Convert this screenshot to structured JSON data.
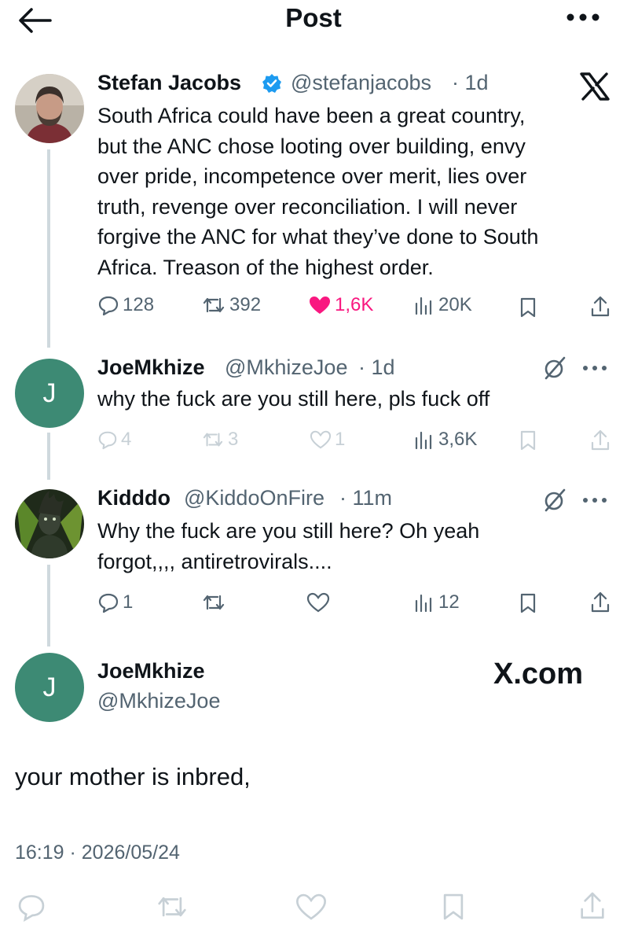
{
  "header": {
    "title": "Post"
  },
  "tweets": [
    {
      "name": "Stefan Jacobs",
      "handle": "@stefanjacobs",
      "time": "· 1d",
      "verified": true,
      "text_lines": [
        "South Africa could have been a great country,",
        "but the ANC chose looting over building, envy",
        "over pride, incompetence over merit, lies over",
        "truth, revenge over reconciliation. I will never",
        "forgive the ANC for what they’ve done to South",
        "Africa. Treason of the highest order."
      ],
      "replies": "128",
      "reposts": "392",
      "likes": "1,6K",
      "views": "20K"
    },
    {
      "name": "JoeMkhize",
      "handle": "@MkhizeJoe",
      "time": "· 1d",
      "avatar_letter": "J",
      "text_lines": [
        "why the fuck are you still here, pls fuck off"
      ],
      "replies": "4",
      "reposts": "3",
      "likes": "1",
      "views": "3,6K"
    },
    {
      "name": "Kidddo",
      "handle": "@KiddoOnFire",
      "time": "· 11m",
      "text_lines": [
        "Why the fuck are you still here?  Oh yeah",
        "forgot,,,, antiretrovirals...."
      ],
      "replies": "1",
      "views": "12"
    }
  ],
  "main": {
    "name": "JoeMkhize",
    "handle": "@MkhizeJoe",
    "avatar_letter": "J",
    "watermark": "X.com",
    "text": "your mother is inbred,",
    "timestamp": "16:19 · 2026/05/24"
  },
  "colors": {
    "accent": "#1d9bf0",
    "like": "#f91880",
    "avatar_j": "#3d8a74",
    "muted": "#536471"
  }
}
